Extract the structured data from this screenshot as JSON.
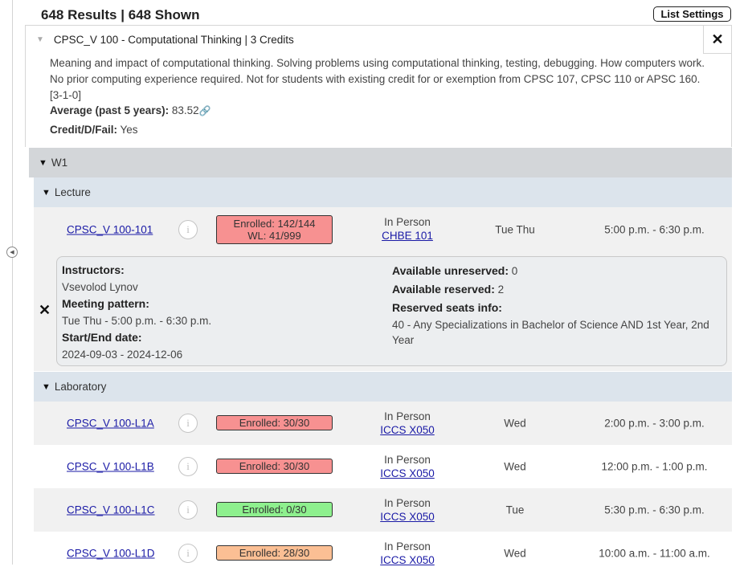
{
  "header": {
    "results_title": "648 Results | 648 Shown",
    "list_settings_label": "List Settings"
  },
  "course": {
    "title": "CPSC_V 100 - Computational Thinking | 3 Credits",
    "description": "Meaning and impact of computational thinking. Solving problems using computational thinking, testing, debugging. How computers work. No prior computing experience required. Not for students with existing credit for or exemption from CPSC 107, CPSC 110 or APSC 160. [3-1-0]",
    "average_label": "Average (past 5 years):",
    "average_value": "83.52",
    "credit_label": "Credit/D/Fail:",
    "credit_value": "Yes",
    "close_label": "✕"
  },
  "term": {
    "label": "W1"
  },
  "groups": {
    "lecture": "Lecture",
    "laboratory": "Laboratory"
  },
  "lecture": {
    "section": "CPSC_V 100-101",
    "enrolled": "Enrolled: 142/144",
    "waitlist": "WL: 41/999",
    "enroll_color": "#f79191",
    "mode": "In Person",
    "room": "CHBE 101",
    "days": "Tue Thu",
    "time": "5:00 p.m. - 6:30 p.m."
  },
  "detail": {
    "close_label": "✕",
    "instructors_label": "Instructors:",
    "instructors_value": "Vsevolod Lynov",
    "pattern_label": "Meeting pattern:",
    "pattern_value": "Tue Thu - 5:00 p.m. - 6:30 p.m.",
    "dates_label": "Start/End date:",
    "dates_value": "2024-09-03 - 2024-12-06",
    "unreserved_label": "Available unreserved:",
    "unreserved_value": "0",
    "reserved_label": "Available reserved:",
    "reserved_value": "2",
    "reserved_info_label": "Reserved seats info:",
    "reserved_info_value": "40 - Any Specializations in Bachelor of Science AND 1st Year, 2nd Year"
  },
  "labs": [
    {
      "section": "CPSC_V 100-L1A",
      "enrolled": "Enrolled: 30/30",
      "color": "#f79191",
      "mode": "In Person",
      "room": "ICCS X050",
      "days": "Wed",
      "time": "2:00 p.m. - 3:00 p.m."
    },
    {
      "section": "CPSC_V 100-L1B",
      "enrolled": "Enrolled: 30/30",
      "color": "#f79191",
      "mode": "In Person",
      "room": "ICCS X050",
      "days": "Wed",
      "time": "12:00 p.m. - 1:00 p.m."
    },
    {
      "section": "CPSC_V 100-L1C",
      "enrolled": "Enrolled: 0/30",
      "color": "#8ef08e",
      "mode": "In Person",
      "room": "ICCS X050",
      "days": "Tue",
      "time": "5:30 p.m. - 6:30 p.m."
    },
    {
      "section": "CPSC_V 100-L1D",
      "enrolled": "Enrolled: 28/30",
      "color": "#fbbf94",
      "mode": "In Person",
      "room": "ICCS X050",
      "days": "Wed",
      "time": "10:00 a.m. - 11:00 a.m."
    }
  ]
}
